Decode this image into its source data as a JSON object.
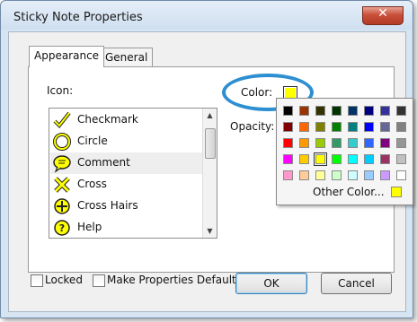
{
  "window": {
    "title": "Sticky Note Properties"
  },
  "tabs": [
    {
      "label": "Appearance",
      "active": true
    },
    {
      "label": "General",
      "active": false
    }
  ],
  "appearance": {
    "icon_label": "Icon:",
    "color_label": "Color:",
    "opacity_label": "Opacity:",
    "selected_color": "#ffff00",
    "icons": [
      {
        "label": "Checkmark",
        "icon": "checkmark-icon",
        "selected": false
      },
      {
        "label": "Circle",
        "icon": "circle-icon",
        "selected": false
      },
      {
        "label": "Comment",
        "icon": "comment-icon",
        "selected": true
      },
      {
        "label": "Cross",
        "icon": "cross-icon",
        "selected": false
      },
      {
        "label": "Cross Hairs",
        "icon": "cross-hairs-icon",
        "selected": false
      },
      {
        "label": "Help",
        "icon": "help-icon",
        "selected": false
      }
    ]
  },
  "palette": {
    "rows": [
      [
        "#000000",
        "#993300",
        "#333300",
        "#003300",
        "#003366",
        "#000080",
        "#333399",
        "#333333"
      ],
      [
        "#800000",
        "#ff6600",
        "#808000",
        "#008000",
        "#008080",
        "#0000ff",
        "#666699",
        "#808080"
      ],
      [
        "#ff0000",
        "#ff9900",
        "#99cc00",
        "#339966",
        "#33cccc",
        "#3366ff",
        "#800080",
        "#969696"
      ],
      [
        "#ff00ff",
        "#ffcc00",
        "#ffff00",
        "#00ff00",
        "#00ffff",
        "#00ccff",
        "#993366",
        "#c0c0c0"
      ],
      [
        "#ff99cc",
        "#ffcc99",
        "#ffff99",
        "#ccffcc",
        "#ccffff",
        "#99ccff",
        "#cc99ff",
        "#ffffff"
      ]
    ],
    "selected": [
      3,
      2
    ],
    "other_label": "Other Color...",
    "other_color": "#ffff00"
  },
  "footer": {
    "locked_label": "Locked",
    "default_label": "Make Properties Default",
    "ok_label": "OK",
    "cancel_label": "Cancel"
  },
  "colors": {
    "highlight": "#2d8fd2",
    "icon_fill": "#ffff00"
  }
}
